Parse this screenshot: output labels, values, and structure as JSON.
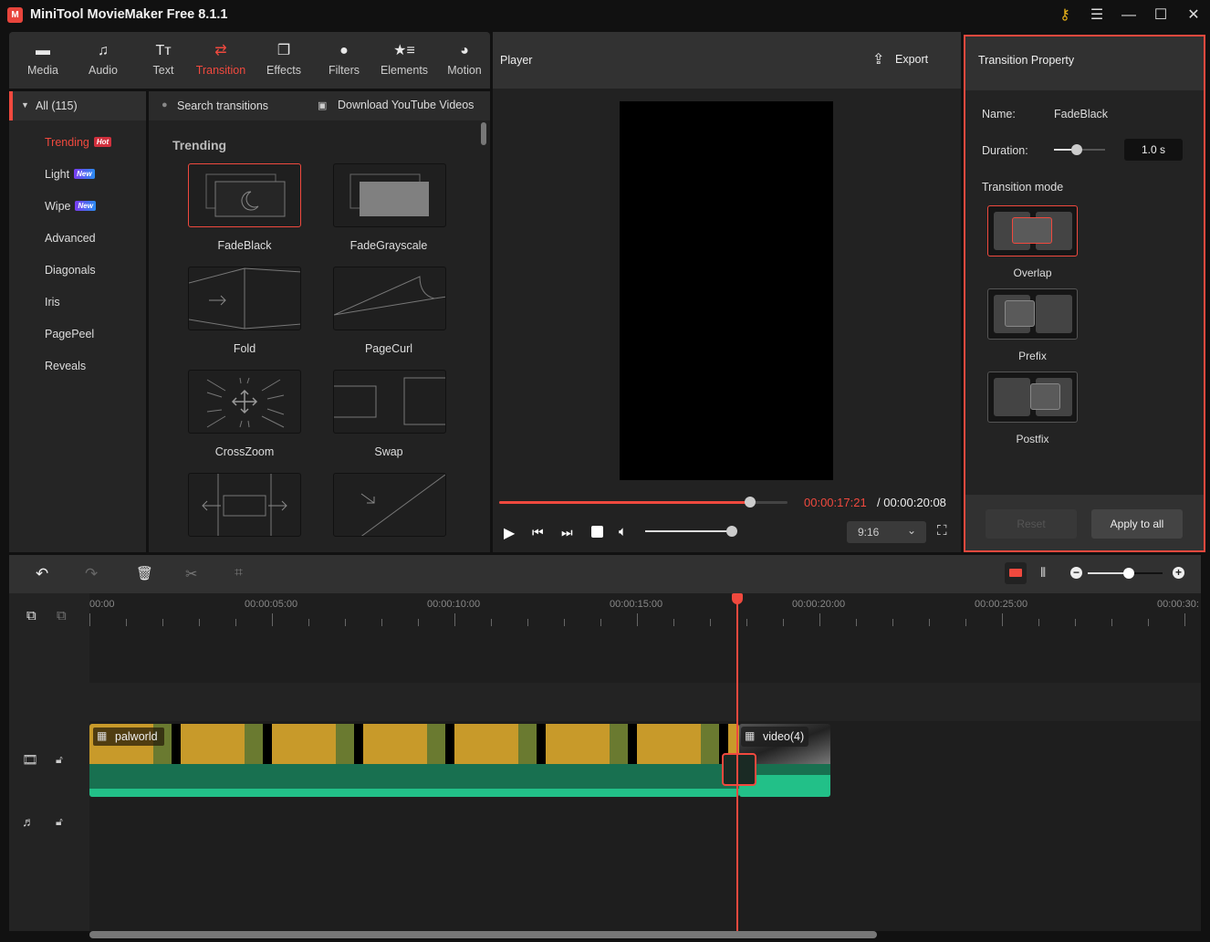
{
  "app": {
    "title": "MiniTool MovieMaker Free 8.1.1",
    "logo": "minitool-logo"
  },
  "window_controls": [
    "key-icon",
    "menu-icon",
    "minimize-icon",
    "maximize-icon",
    "close-icon"
  ],
  "toolbar": {
    "items": [
      {
        "label": "Media",
        "icon": "folder-icon"
      },
      {
        "label": "Audio",
        "icon": "music-icon"
      },
      {
        "label": "Text",
        "icon": "text-icon"
      },
      {
        "label": "Transition",
        "icon": "transition-icon",
        "active": true
      },
      {
        "label": "Effects",
        "icon": "effects-icon"
      },
      {
        "label": "Filters",
        "icon": "filters-icon"
      },
      {
        "label": "Elements",
        "icon": "elements-icon"
      },
      {
        "label": "Motion",
        "icon": "motion-icon"
      }
    ]
  },
  "categories": {
    "all_label": "All (115)",
    "items": [
      {
        "label": "Trending",
        "badge": "Hot",
        "active": true
      },
      {
        "label": "Light",
        "badge": "New"
      },
      {
        "label": "Wipe",
        "badge": "New"
      },
      {
        "label": "Advanced"
      },
      {
        "label": "Diagonals"
      },
      {
        "label": "Iris"
      },
      {
        "label": "PagePeel"
      },
      {
        "label": "Reveals"
      }
    ]
  },
  "grid": {
    "search_placeholder": "Search transitions",
    "download_label": "Download YouTube Videos",
    "section_title": "Trending",
    "items": [
      {
        "label": "FadeBlack",
        "selected": true
      },
      {
        "label": "FadeGrayscale"
      },
      {
        "label": "Fold"
      },
      {
        "label": "PageCurl"
      },
      {
        "label": "CrossZoom"
      },
      {
        "label": "Swap"
      },
      {
        "label": ""
      },
      {
        "label": ""
      }
    ]
  },
  "player": {
    "title": "Player",
    "export_label": "Export",
    "current_time": "00:00:17:21",
    "total_time": "/ 00:00:20:08",
    "progress": 0.87,
    "volume": 1.0,
    "aspect_ratio": "9:16"
  },
  "properties": {
    "title": "Transition Property",
    "name_label": "Name:",
    "name_value": "FadeBlack",
    "duration_label": "Duration:",
    "duration_value": "1.0 s",
    "duration_fraction": 0.45,
    "mode_label": "Transition mode",
    "modes": [
      {
        "label": "Overlap",
        "selected": true
      },
      {
        "label": "Prefix"
      },
      {
        "label": "Postfix"
      }
    ],
    "reset_label": "Reset",
    "apply_label": "Apply to all"
  },
  "timeline": {
    "ruler": [
      "00:00",
      "00:00:05:00",
      "00:00:10:00",
      "00:00:15:00",
      "00:00:20:00",
      "00:00:25:00",
      "00:00:30:"
    ],
    "playhead_time": "00:00:17:21",
    "zoom_fraction": 0.55,
    "clips": [
      {
        "name": "palworld",
        "start_s": 0,
        "end_s": 17.8
      },
      {
        "name": "video(4)",
        "start_s": 17.8,
        "end_s": 20.3
      }
    ]
  },
  "colors": {
    "accent": "#f0493e",
    "audio_wave": "#22c088",
    "audio_bg": "#187050"
  }
}
